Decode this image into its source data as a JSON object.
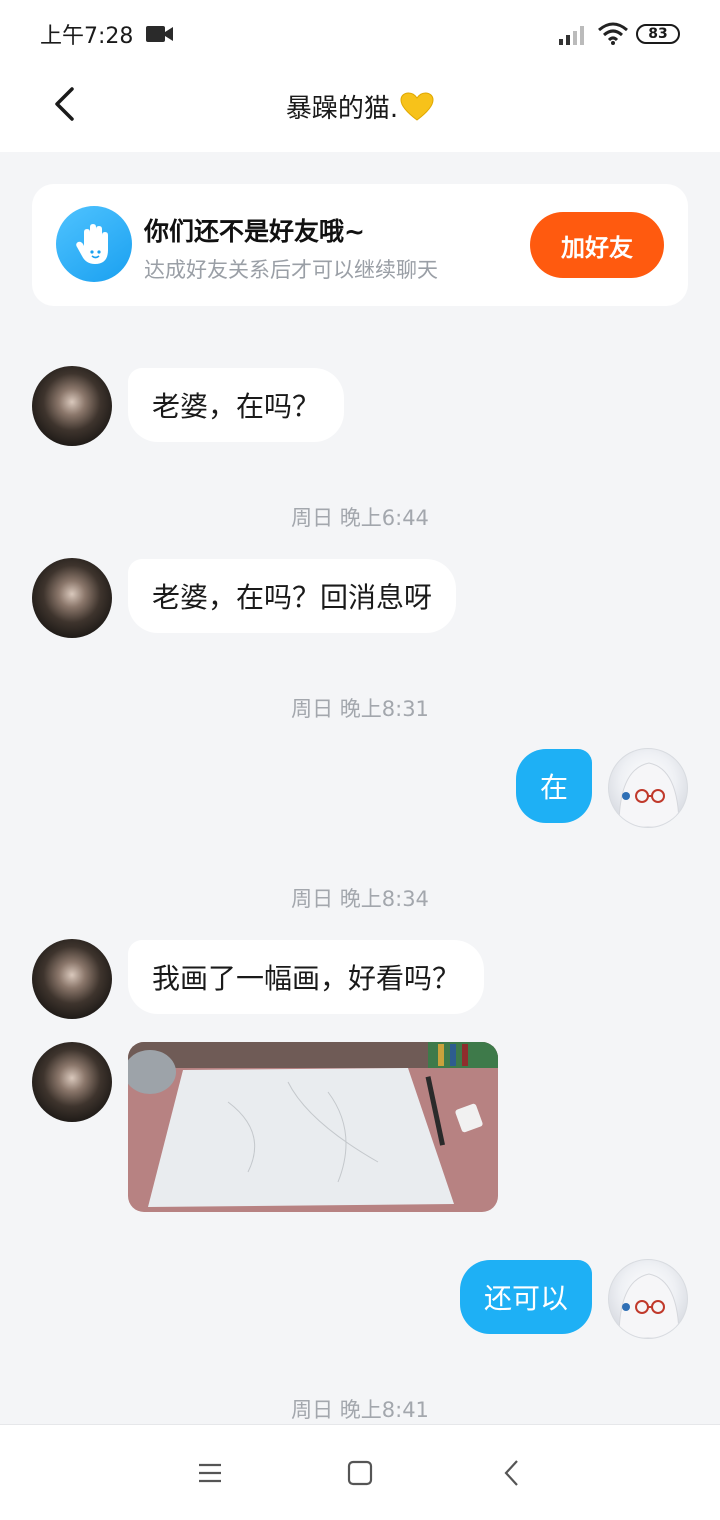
{
  "status_bar": {
    "time": "上午7:28",
    "battery": "83",
    "icons": [
      "video-camera-icon",
      "signal-icon",
      "wifi-icon",
      "battery-icon"
    ]
  },
  "header": {
    "title": "暴躁的猫.",
    "title_emoji_icon": "yellow-heart-icon",
    "back_icon": "chevron-left-icon"
  },
  "notice": {
    "title": "你们还不是好友哦~",
    "subtitle": "达成好友关系后才可以继续聊天",
    "button_label": "加好友",
    "icon": "hand-wave-icon",
    "accent_color": "#ff5a0f"
  },
  "messages": [
    {
      "side": "in",
      "text": "老婆，在吗？"
    },
    {
      "type": "time",
      "text": "周日 晚上6:44"
    },
    {
      "side": "in",
      "text": "老婆，在吗？回消息呀"
    },
    {
      "type": "time",
      "text": "周日 晚上8:31"
    },
    {
      "side": "out",
      "text": "在"
    },
    {
      "type": "time",
      "text": "周日 晚上8:34"
    },
    {
      "side": "in",
      "text": "我画了一幅画，好看吗？"
    },
    {
      "side": "in",
      "type": "image",
      "content": "photo-of-drawing"
    },
    {
      "side": "out",
      "text": "还可以"
    },
    {
      "type": "time",
      "text": "周日 晚上8:41"
    }
  ],
  "colors": {
    "outgoing_bubble": "#1eb0f5",
    "incoming_bubble": "#ffffff",
    "background": "#f4f5f7"
  },
  "nav_bar": {
    "icons": [
      "menu-icon",
      "home-square-icon",
      "back-chevron-icon"
    ]
  }
}
